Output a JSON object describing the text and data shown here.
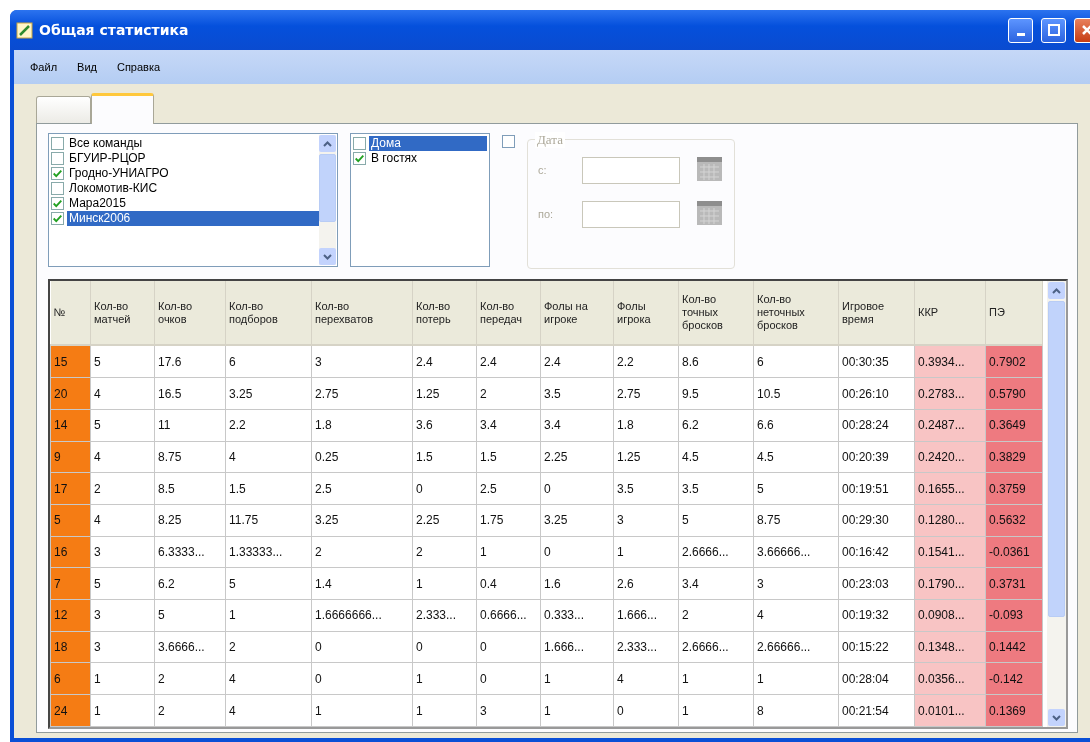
{
  "window": {
    "title": "Общая статистика"
  },
  "menu": [
    "Файл",
    "Вид",
    "Справка"
  ],
  "tabs": [
    {
      "selected": false
    },
    {
      "selected": true
    }
  ],
  "teams": [
    {
      "label": "Все команды",
      "checked": false,
      "selected": false
    },
    {
      "label": "БГУИР-РЦОР",
      "checked": false,
      "selected": false
    },
    {
      "label": "Гродно-УНИАГРО",
      "checked": true,
      "selected": false
    },
    {
      "label": "Локомотив-КИС",
      "checked": false,
      "selected": false
    },
    {
      "label": "Мара2015",
      "checked": true,
      "selected": false
    },
    {
      "label": "Минск2006",
      "checked": true,
      "selected": true
    }
  ],
  "venues": [
    {
      "label": "Дома",
      "checked": false,
      "selected": true
    },
    {
      "label": "В гостях",
      "checked": true,
      "selected": false
    }
  ],
  "date_filter": {
    "checked": false,
    "enabled": false,
    "legend": "Дата",
    "from_label": "с:",
    "to_label": "по:"
  },
  "table": {
    "columns": [
      {
        "label": "№",
        "color": "#f57c14"
      },
      {
        "label": "Кол-во матчей"
      },
      {
        "label": "Кол-во очков"
      },
      {
        "label": "Кол-во подборов"
      },
      {
        "label": "Кол-во перехватов"
      },
      {
        "label": "Кол-во потерь"
      },
      {
        "label": "Кол-во передач"
      },
      {
        "label": "Фолы на игроке"
      },
      {
        "label": "Фолы игрока"
      },
      {
        "label": "Кол-во точных бросков"
      },
      {
        "label": "Кол-во неточных бросков"
      },
      {
        "label": "Игровое время"
      },
      {
        "label": "ККР",
        "color": "#f8c4c4"
      },
      {
        "label": "ПЭ",
        "color": "#ee7a80"
      }
    ],
    "rows": [
      [
        "15",
        "5",
        "17.6",
        "6",
        "3",
        "2.4",
        "2.4",
        "2.4",
        "2.2",
        "8.6",
        "6",
        "00:30:35",
        "0.3934...",
        "0.7902"
      ],
      [
        "20",
        "4",
        "16.5",
        "3.25",
        "2.75",
        "1.25",
        "2",
        "3.5",
        "2.75",
        "9.5",
        "10.5",
        "00:26:10",
        "0.2783...",
        "0.5790"
      ],
      [
        "14",
        "5",
        "11",
        "2.2",
        "1.8",
        "3.6",
        "3.4",
        "3.4",
        "1.8",
        "6.2",
        "6.6",
        "00:28:24",
        "0.2487...",
        "0.3649"
      ],
      [
        "9",
        "4",
        "8.75",
        "4",
        "0.25",
        "1.5",
        "1.5",
        "2.25",
        "1.25",
        "4.5",
        "4.5",
        "00:20:39",
        "0.2420...",
        "0.3829"
      ],
      [
        "17",
        "2",
        "8.5",
        "1.5",
        "2.5",
        "0",
        "2.5",
        "0",
        "3.5",
        "3.5",
        "5",
        "00:19:51",
        "0.1655...",
        "0.3759"
      ],
      [
        "5",
        "4",
        "8.25",
        "11.75",
        "3.25",
        "2.25",
        "1.75",
        "3.25",
        "3",
        "5",
        "8.75",
        "00:29:30",
        "0.1280...",
        "0.5632"
      ],
      [
        "16",
        "3",
        "6.3333...",
        "1.33333...",
        "2",
        "2",
        "1",
        "0",
        "1",
        "2.6666...",
        "3.66666...",
        "00:16:42",
        "0.1541...",
        "-0.0361"
      ],
      [
        "7",
        "5",
        "6.2",
        "5",
        "1.4",
        "1",
        "0.4",
        "1.6",
        "2.6",
        "3.4",
        "3",
        "00:23:03",
        "0.1790...",
        "0.3731"
      ],
      [
        "12",
        "3",
        "5",
        "1",
        "1.6666666...",
        "2.333...",
        "0.6666...",
        "0.333...",
        "1.666...",
        "2",
        "4",
        "00:19:32",
        "0.0908...",
        "-0.093"
      ],
      [
        "18",
        "3",
        "3.6666...",
        "2",
        "0",
        "0",
        "0",
        "1.666...",
        "2.333...",
        "2.6666...",
        "2.66666...",
        "00:15:22",
        "0.1348...",
        "0.1442"
      ],
      [
        "6",
        "1",
        "2",
        "4",
        "0",
        "1",
        "0",
        "1",
        "4",
        "1",
        "1",
        "00:28:04",
        "0.0356...",
        "-0.142"
      ],
      [
        "24",
        "1",
        "2",
        "4",
        "1",
        "1",
        "3",
        "1",
        "0",
        "1",
        "8",
        "00:21:54",
        "0.0101...",
        "0.1369"
      ]
    ]
  }
}
